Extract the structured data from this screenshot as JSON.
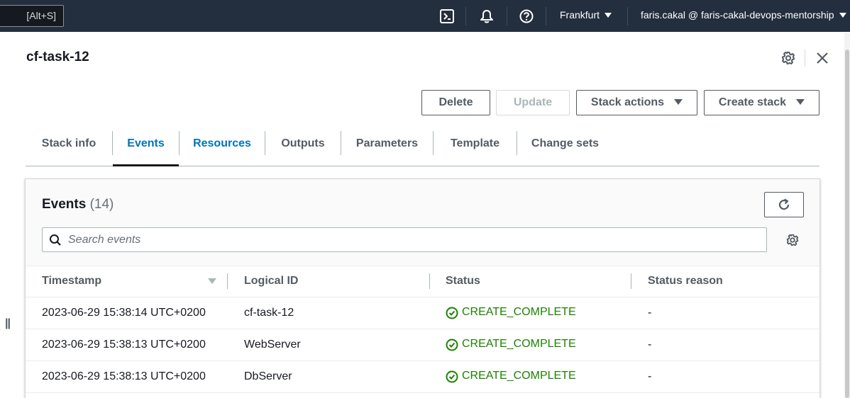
{
  "topnav": {
    "shortcut_label": "[Alt+S]",
    "icons": [
      "cloudshell-icon",
      "bell-icon",
      "help-icon"
    ],
    "region": "Frankfurt",
    "account": "faris.cakal @ faris-cakal-devops-mentorship"
  },
  "panel": {
    "title": "cf-task-12"
  },
  "actions": {
    "delete": "Delete",
    "update": "Update",
    "stack_actions": "Stack actions",
    "create_stack": "Create stack"
  },
  "tabs": [
    {
      "label": "Stack info"
    },
    {
      "label": "Events"
    },
    {
      "label": "Resources"
    },
    {
      "label": "Outputs"
    },
    {
      "label": "Parameters"
    },
    {
      "label": "Template"
    },
    {
      "label": "Change sets"
    }
  ],
  "events": {
    "title": "Events",
    "count": "(14)",
    "search_placeholder": "Search events",
    "columns": [
      "Timestamp",
      "Logical ID",
      "Status",
      "Status reason"
    ],
    "rows": [
      {
        "timestamp": "2023-06-29 15:38:14 UTC+0200",
        "logical_id": "cf-task-12",
        "status": "CREATE_COMPLETE",
        "reason": "-"
      },
      {
        "timestamp": "2023-06-29 15:38:13 UTC+0200",
        "logical_id": "WebServer",
        "status": "CREATE_COMPLETE",
        "reason": "-"
      },
      {
        "timestamp": "2023-06-29 15:38:13 UTC+0200",
        "logical_id": "DbServer",
        "status": "CREATE_COMPLETE",
        "reason": "-"
      }
    ]
  },
  "colors": {
    "nav_bg": "#232f3e",
    "link": "#0073bb",
    "success": "#1d8102",
    "text": "#16191f"
  }
}
